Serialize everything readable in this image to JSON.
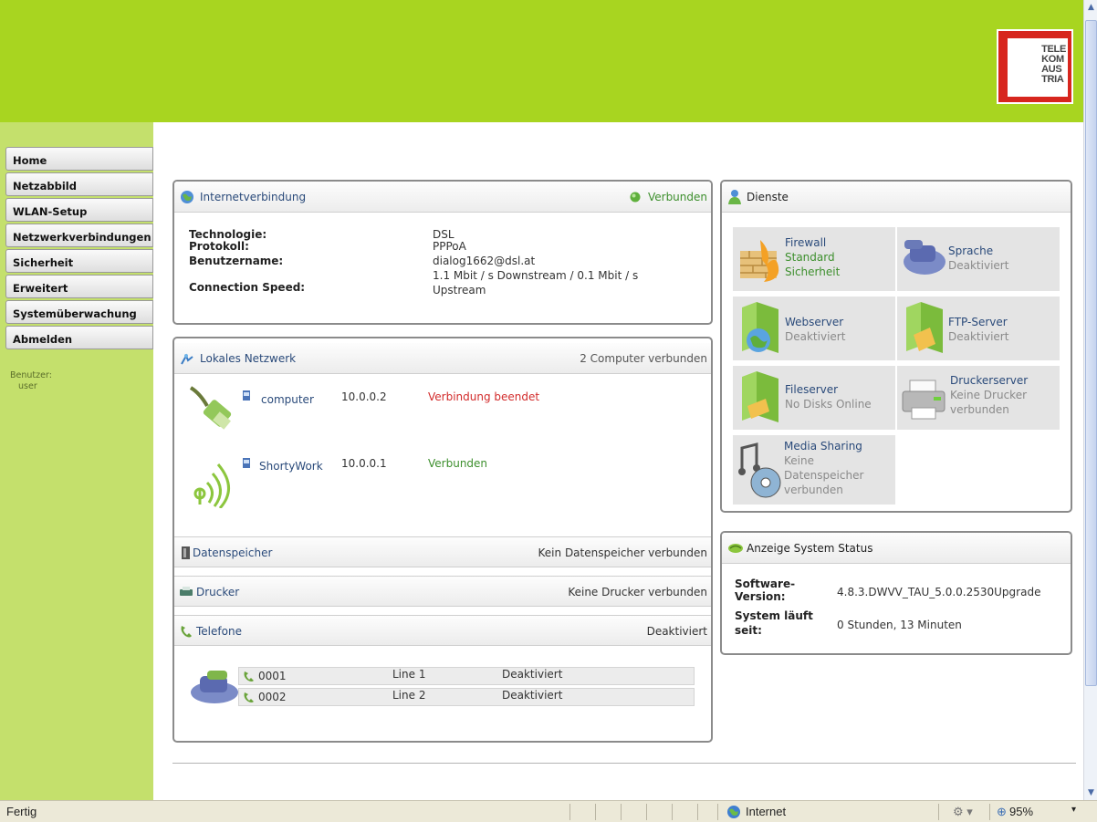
{
  "header": {
    "logo_lines": [
      "TELE",
      "KOM",
      "AUS",
      "TRIA"
    ]
  },
  "sidebar": {
    "items": [
      {
        "label": "Home"
      },
      {
        "label": "Netzabbild"
      },
      {
        "label": "WLAN-Setup"
      },
      {
        "label": "Netzwerkverbindungen"
      },
      {
        "label": "Sicherheit"
      },
      {
        "label": "Erweitert"
      },
      {
        "label": "Systemüberwachung"
      },
      {
        "label": "Abmelden"
      }
    ],
    "user_label": "Benutzer:",
    "user_value": "user"
  },
  "internet": {
    "title": "Internetverbindung",
    "status": "Verbunden",
    "rows": [
      {
        "label": "Technologie:",
        "value": "DSL"
      },
      {
        "label": "Protokoll:",
        "value": "PPPoA"
      },
      {
        "label": "Benutzername:",
        "value": "dialog1662@dsl.at"
      },
      {
        "label": "Connection Speed:",
        "value_line1": "1.1 Mbit / s Downstream / 0.1 Mbit / s",
        "value_line2": "Upstream"
      }
    ]
  },
  "lan": {
    "title": "Lokales Netzwerk",
    "summary": "2 Computer verbunden",
    "devices": [
      {
        "name": "computer",
        "ip": "10.0.0.2",
        "status": "Verbindung beendet"
      },
      {
        "name": "ShortyWork",
        "ip": "10.0.0.1",
        "status": "Verbunden"
      }
    ]
  },
  "storage": {
    "title": "Datenspeicher",
    "status": "Kein Datenspeicher verbunden"
  },
  "printer": {
    "title": "Drucker",
    "status": "Keine Drucker verbunden"
  },
  "phones": {
    "title": "Telefone",
    "status": "Deaktiviert",
    "lines": [
      {
        "number": "0001",
        "line": "Line 1",
        "status": "Deaktiviert"
      },
      {
        "number": "0002",
        "line": "Line 2",
        "status": "Deaktiviert"
      }
    ]
  },
  "services": {
    "title": "Dienste",
    "firewall": {
      "name": "Firewall",
      "sub1": "Standard",
      "sub2": "Sicherheit"
    },
    "voice": {
      "name": "Sprache",
      "sub1": "Deaktiviert"
    },
    "webserver": {
      "name": "Webserver",
      "sub1": "Deaktiviert"
    },
    "ftp": {
      "name": "FTP-Server",
      "sub1": "Deaktiviert"
    },
    "fileserver": {
      "name": "Fileserver",
      "sub1": "No Disks Online"
    },
    "printserver": {
      "name": "Druckerserver",
      "sub1": "Keine Drucker",
      "sub2": "verbunden"
    },
    "media": {
      "name": "Media Sharing",
      "sub1": "Keine",
      "sub2": "Datenspeicher",
      "sub3": "verbunden"
    }
  },
  "system": {
    "title": "Anzeige System Status",
    "software_label_1": "Software-",
    "software_label_2": "Version:",
    "software_value": "4.8.3.DWVV_TAU_5.0.0.2530Upgrade",
    "uptime_label_1": "System läuft",
    "uptime_label_2": "seit:",
    "uptime_value": "0 Stunden, 13 Minuten"
  },
  "statusbar": {
    "left": "Fertig",
    "zone": "Internet",
    "zoom": "95%"
  },
  "colors": {
    "header_green": "#a8d520",
    "sidebar_green": "#c4e06c",
    "connected_green": "#3d8f2d",
    "disconnected_red": "#d22a2a"
  }
}
